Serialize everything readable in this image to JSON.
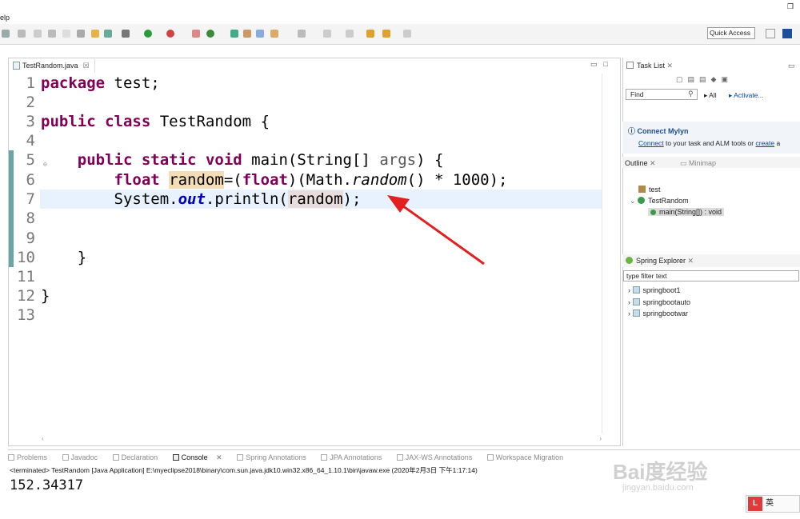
{
  "menubar": {
    "help": "elp"
  },
  "toolbar": {
    "quick_access": "Quick Access"
  },
  "editor": {
    "tab_title": "TestRandom.java",
    "tab_close": "☒",
    "lines": {
      "n1": "1",
      "n2": "2",
      "n3": "3",
      "n4": "4",
      "n5": "5",
      "n6": "6",
      "n7": "7",
      "n8": "8",
      "n9": "9",
      "n10": "10",
      "n11": "11",
      "n12": "12",
      "n13": "13"
    },
    "code": {
      "l1_kw": "package",
      "l1_rest": " test;",
      "l3_kw1": "public",
      "l3_kw2": "class",
      "l3_rest": " TestRandom {",
      "l5_kw1": "public",
      "l5_kw2": "static",
      "l5_kw3": "void",
      "l5_rest": " main(String[] ",
      "l5_arg": "args",
      "l5_end": ") {",
      "l6_kw": "float",
      "l6_var": "random",
      "l6_a": "=(",
      "l6_kw2": "float",
      "l6_b": ")(Math.",
      "l6_method": "random",
      "l6_c": "() * 1000);",
      "l7_a": "System.",
      "l7_field": "out",
      "l7_b": ".println(",
      "l7_var": "random",
      "l7_c": ");",
      "l10": "}",
      "l12": "}"
    }
  },
  "task_list": {
    "title": "Task List",
    "find_placeholder": "Find",
    "all": "All",
    "activate": "Activate...",
    "mylyn_title": "Connect Mylyn",
    "mylyn_connect": "Connect",
    "mylyn_text": " to your task and ALM tools or ",
    "mylyn_create": "create",
    "mylyn_tail": " a"
  },
  "outline": {
    "title": "Outline",
    "minimap": "Minimap",
    "items": [
      "test",
      "TestRandom",
      "main(String[]) : void"
    ]
  },
  "spring_explorer": {
    "title": "Spring Explorer",
    "filter_placeholder": "type filter text",
    "projects": [
      "springboot1",
      "springbootauto",
      "springbootwar"
    ]
  },
  "bottom": {
    "tabs": [
      "Problems",
      "Javadoc",
      "Declaration",
      "Console",
      "Spring Annotations",
      "JPA Annotations",
      "JAX-WS Annotations",
      "Workspace Migration"
    ],
    "terminated": "<terminated> TestRandom [Java Application] E:\\myeclipse2018\\binary\\com.sun.java.jdk10.win32.x86_64_1.10.1\\bin\\javaw.exe (2020年2月3日 下午1:17:14)",
    "output": "152.34317"
  },
  "watermark": {
    "brand": "Bai度经验",
    "url": "jingyan.baidu.com"
  },
  "ime": {
    "label": "英"
  }
}
